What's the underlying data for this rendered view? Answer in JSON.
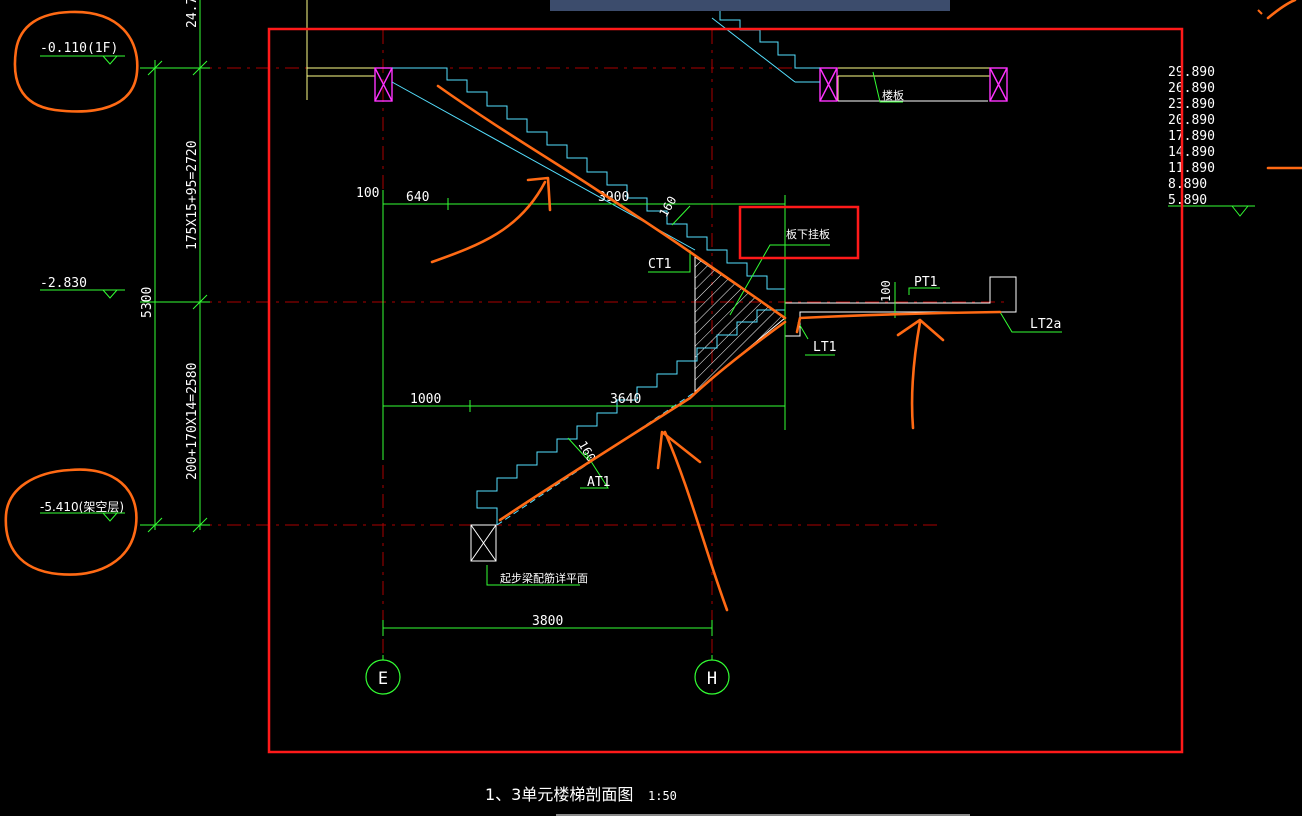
{
  "colors": {
    "background": "#000000",
    "dim_green": "#33ff33",
    "stair_cyan": "#55e0ff",
    "slab_yellow": "#ffff88",
    "white": "#ffffff",
    "magenta": "#ff33ff",
    "axis_red": "#aa0000",
    "markup_orange": "#ff6a14",
    "markup_red": "#ff1a1a",
    "header_bar": "#3c4c6c"
  },
  "left_levels": {
    "top_fragment": "24.7",
    "level_1f": "-0.110(1F)",
    "level_mid": "-2.830",
    "level_bottom": "-5.410(架空层)",
    "upper_flight_dim": "175X15+95=2720",
    "lower_flight_dim": "200+170X14=2580",
    "total_height": "5300"
  },
  "right_levels": [
    "29.890",
    "26.890",
    "23.890",
    "20.890",
    "17.890",
    "14.890",
    "11.890",
    "8.890",
    "5.890"
  ],
  "dims": {
    "d100_upper": "100",
    "d640": "640",
    "d3900": "3900",
    "d160_upper": "160",
    "d1000": "1000",
    "d3640": "3640",
    "d160_lower": "160",
    "d3800": "3800",
    "d100_platform": "100"
  },
  "labels": {
    "ct1": "CT1",
    "at1": "AT1",
    "pt1": "PT1",
    "lt1": "LT1",
    "lt2a": "LT2a",
    "floor_slab": "楼板",
    "hanging_slab": "板下挂板",
    "start_beam": "起步梁配筋详平面"
  },
  "axes": {
    "axis_e": "E",
    "axis_h": "H"
  },
  "title": {
    "main": "1、3单元楼梯剖面图",
    "scale": "1:50"
  }
}
